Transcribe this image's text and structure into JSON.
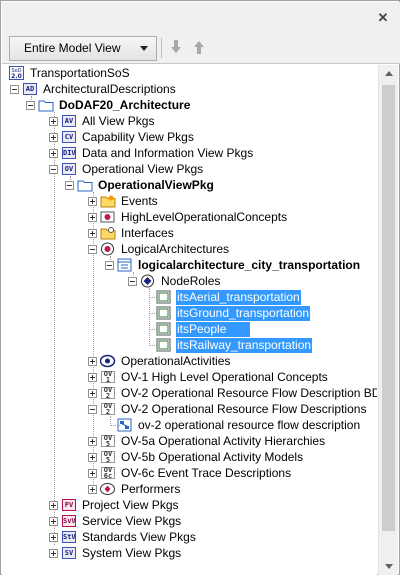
{
  "window": {
    "close_icon": "close-icon"
  },
  "toolbar": {
    "view_selector_value": "Entire Model View",
    "down_arrow_icon": "arrow-down-icon",
    "up_arrow_icon": "arrow-up-icon"
  },
  "tree": {
    "items": [
      {
        "label": "TransportationSoS",
        "icon": "model-icon"
      },
      {
        "label": "ArchitecturalDescriptions",
        "icon": "ad-icon"
      },
      {
        "label": "DoDAF20_Architecture",
        "icon": "folder-icon"
      },
      {
        "label": "All View Pkgs",
        "icon": "av-package-icon"
      },
      {
        "label": "Capability View Pkgs",
        "icon": "cv-package-icon"
      },
      {
        "label": "Data and Information View Pkgs",
        "icon": "dv-package-icon"
      },
      {
        "label": "Operational View Pkgs",
        "icon": "ov-package-icon"
      },
      {
        "label": "OperationalViewPkg",
        "icon": "folder-icon"
      },
      {
        "label": "Events",
        "icon": "events-folder-icon"
      },
      {
        "label": "HighLevelOperationalConcepts",
        "icon": "concepts-icon"
      },
      {
        "label": "Interfaces",
        "icon": "interfaces-folder-icon"
      },
      {
        "label": "LogicalArchitectures",
        "icon": "logical-architecture-icon"
      },
      {
        "label": "logicalarchitecture_city_transportation",
        "icon": "architecture-element-icon"
      },
      {
        "label": "NodeRoles",
        "icon": "node-roles-icon"
      },
      {
        "label": "itsAerial_transportation",
        "icon": "node-role-icon"
      },
      {
        "label": "itsGround_transportation",
        "icon": "node-role-icon"
      },
      {
        "label": "itsPeople",
        "icon": "node-role-icon"
      },
      {
        "label": "itsRailway_transportation",
        "icon": "node-role-icon"
      },
      {
        "label": "OperationalActivities",
        "icon": "activities-icon"
      },
      {
        "label": "OV-1 High Level Operational Concepts",
        "icon": "ov1-icon"
      },
      {
        "label": "OV-2 Operational Resource Flow Description BD",
        "icon": "ov2-icon"
      },
      {
        "label": "OV-2 Operational Resource Flow Descriptions",
        "icon": "ov2-icon"
      },
      {
        "label": "ov-2 operational resource flow description",
        "icon": "diagram-icon"
      },
      {
        "label": "OV-5a Operational Activity Hierarchies",
        "icon": "ov5-icon"
      },
      {
        "label": "OV-5b Operational Activity Models",
        "icon": "ov5-icon"
      },
      {
        "label": "OV-6c Event Trace Descriptions",
        "icon": "ov6c-icon"
      },
      {
        "label": "Performers",
        "icon": "performers-icon"
      },
      {
        "label": "Project View Pkgs",
        "icon": "pv-package-icon"
      },
      {
        "label": "Service View Pkgs",
        "icon": "sv-package-icon"
      },
      {
        "label": "Standards View Pkgs",
        "icon": "stv-package-icon"
      },
      {
        "label": "System View Pkgs",
        "icon": "sysv-package-icon"
      }
    ]
  },
  "colors": {
    "selection": "#3399ff",
    "badge": "#3f51b5"
  }
}
